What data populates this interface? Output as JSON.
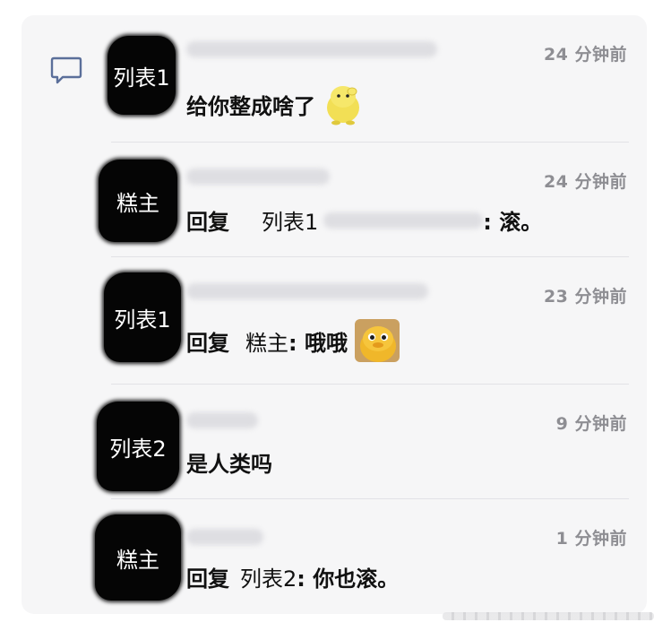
{
  "comments": [
    {
      "avatar_text": "列表1",
      "time": "24 分钟前",
      "message": "给你整成啥了",
      "sticker": "yellow-blob-sticker"
    },
    {
      "avatar_text": "糕主",
      "time": "24 分钟前",
      "reply_prefix": "回复",
      "reply_to": "列表1",
      "message": ": 滚。"
    },
    {
      "avatar_text": "列表1",
      "time": "23 分钟前",
      "reply_prefix": "回复",
      "reply_to": "糕主",
      "message": ": 哦哦",
      "sticker": "yellow-duck-sticker"
    },
    {
      "avatar_text": "列表2",
      "time": "9 分钟前",
      "message": "是人类吗"
    },
    {
      "avatar_text": "糕主",
      "time": "1 分钟前",
      "reply_prefix": "回复",
      "reply_to": "列表2",
      "message": ": 你也滚。"
    }
  ],
  "colors": {
    "card_bg": "#f6f6f7",
    "time_text": "#8e8e93",
    "icon_blue": "#5b6f9a"
  },
  "icons": [
    "comment-bubble-icon"
  ]
}
